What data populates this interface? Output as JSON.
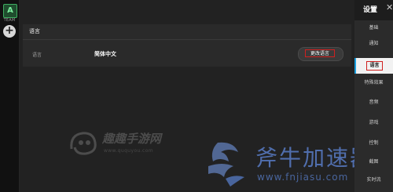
{
  "left_rail": {
    "team_logo": "A",
    "team_label": "TEAM",
    "add_label": "+"
  },
  "panel": {
    "title": "语言",
    "row_label": "语言",
    "row_value": "简体中文",
    "change_button": "更改语言"
  },
  "header": {
    "title": "设置",
    "close": "✕"
  },
  "sidebar": {
    "items": [
      {
        "label": "基础"
      },
      {
        "label": "通知"
      },
      {
        "label": "语言"
      },
      {
        "label": "特殊效果"
      },
      {
        "label": "音频"
      },
      {
        "label": "游戏"
      },
      {
        "label": "控制"
      },
      {
        "label": "截图"
      },
      {
        "label": "实时流"
      }
    ]
  },
  "watermarks": {
    "site1_title": "趣趣手游网",
    "site1_url": "www.ququyou.com",
    "site2_title": "斧牛加速器",
    "site2_url": "www.fnjiasu.com"
  },
  "colors": {
    "highlight_border": "#d0201f",
    "active_indicator": "#1aa0e0"
  }
}
